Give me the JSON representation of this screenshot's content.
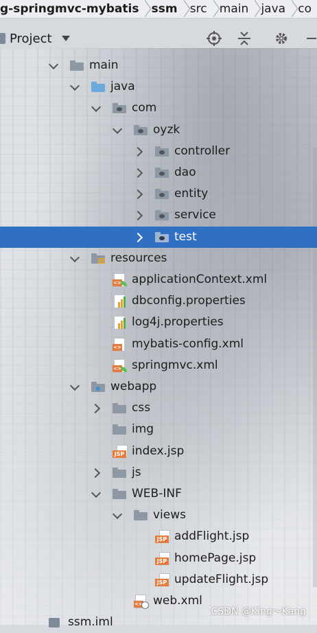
{
  "breadcrumb": {
    "items": [
      "g-springmvc-mybatis",
      "ssm",
      "src",
      "main",
      "java",
      "co"
    ]
  },
  "header": {
    "title": "Project",
    "icons": [
      "locate-icon",
      "collapse-icon",
      "gear-icon",
      "minimize-icon"
    ]
  },
  "tree": [
    {
      "label": "main",
      "depth": 0,
      "arrow": "down",
      "icon": "folder"
    },
    {
      "label": "java",
      "depth": 1,
      "arrow": "down",
      "icon": "folder-blue"
    },
    {
      "label": "com",
      "depth": 2,
      "arrow": "down",
      "icon": "package"
    },
    {
      "label": "oyzk",
      "depth": 3,
      "arrow": "down",
      "icon": "package"
    },
    {
      "label": "controller",
      "depth": 4,
      "arrow": "right",
      "icon": "package"
    },
    {
      "label": "dao",
      "depth": 4,
      "arrow": "right",
      "icon": "package"
    },
    {
      "label": "entity",
      "depth": 4,
      "arrow": "right",
      "icon": "package"
    },
    {
      "label": "service",
      "depth": 4,
      "arrow": "right",
      "icon": "package"
    },
    {
      "label": "test",
      "depth": 4,
      "arrow": "right",
      "icon": "package",
      "selected": true
    },
    {
      "label": "resources",
      "depth": 1,
      "arrow": "down",
      "icon": "resources"
    },
    {
      "label": "applicationContext.xml",
      "depth": 2,
      "arrow": "",
      "icon": "spring-xml"
    },
    {
      "label": "dbconfig.properties",
      "depth": 2,
      "arrow": "",
      "icon": "properties"
    },
    {
      "label": "log4j.properties",
      "depth": 2,
      "arrow": "",
      "icon": "properties"
    },
    {
      "label": "mybatis-config.xml",
      "depth": 2,
      "arrow": "",
      "icon": "xml"
    },
    {
      "label": "springmvc.xml",
      "depth": 2,
      "arrow": "",
      "icon": "spring-xml"
    },
    {
      "label": "webapp",
      "depth": 1,
      "arrow": "down",
      "icon": "web-folder"
    },
    {
      "label": "css",
      "depth": 2,
      "arrow": "right",
      "icon": "folder"
    },
    {
      "label": "img",
      "depth": 2,
      "arrow": "",
      "icon": "folder"
    },
    {
      "label": "index.jsp",
      "depth": 2,
      "arrow": "",
      "icon": "jsp"
    },
    {
      "label": "js",
      "depth": 2,
      "arrow": "right",
      "icon": "folder"
    },
    {
      "label": "WEB-INF",
      "depth": 2,
      "arrow": "down",
      "icon": "folder"
    },
    {
      "label": "views",
      "depth": 3,
      "arrow": "down",
      "icon": "folder"
    },
    {
      "label": "addFlight.jsp",
      "depth": 4,
      "arrow": "",
      "icon": "jsp"
    },
    {
      "label": "homePage.jsp",
      "depth": 4,
      "arrow": "",
      "icon": "jsp"
    },
    {
      "label": "updateFlight.jsp",
      "depth": 4,
      "arrow": "",
      "icon": "jsp"
    },
    {
      "label": "web.xml",
      "depth": 3,
      "arrow": "",
      "icon": "web-xml"
    },
    {
      "label": "ssm.iml",
      "depth": -1,
      "arrow": "",
      "icon": "iml"
    }
  ],
  "watermark": "CSDN @King～Kang",
  "colors": {
    "selection": "#2f6fc4",
    "folder": "#8e98a4",
    "source_folder": "#6aa9de"
  }
}
